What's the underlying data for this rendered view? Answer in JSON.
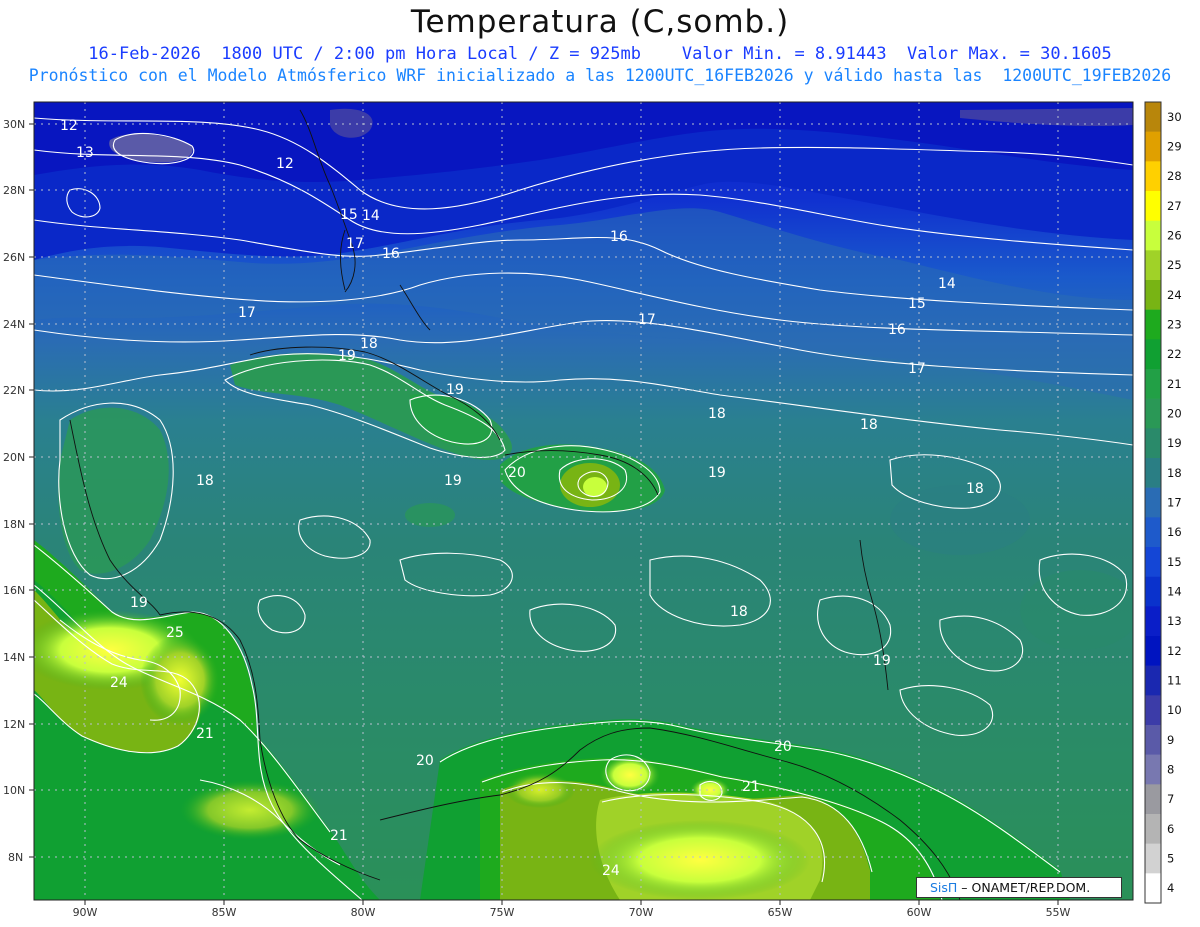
{
  "header": {
    "title": "Temperatura (C,somb.)",
    "line1": "16-Feb-2026  1800 UTC / 2:00 pm Hora Local / Z = 925mb    Valor Min. = 8.91443  Valor Max. = 30.1605",
    "line2": "Pronóstico con el Modelo Atmósferico WRF inicializado a las 1200UTC_16FEB2026 y válido hasta las  1200UTC_19FEB2026"
  },
  "credit": {
    "brand": "SisΠ",
    "text": " – ONAMET/REP.DOM."
  },
  "axes": {
    "lon_labels": [
      "90W",
      "85W",
      "80W",
      "75W",
      "70W",
      "65W",
      "60W",
      "55W"
    ],
    "lat_labels": [
      "30N",
      "28N",
      "26N",
      "24N",
      "22N",
      "20N",
      "18N",
      "16N",
      "14N",
      "12N",
      "10N",
      "8N"
    ]
  },
  "colorbar": {
    "levels": [
      "30",
      "29",
      "28",
      "27",
      "26",
      "25",
      "24",
      "23",
      "22",
      "21",
      "20",
      "19",
      "18",
      "17",
      "16",
      "15",
      "14",
      "13",
      "12",
      "11",
      "10",
      "9",
      "8",
      "7",
      "6",
      "5",
      "4"
    ],
    "colors": [
      "#b8860b",
      "#e0a000",
      "#ffd000",
      "#ffff00",
      "#c8ff3c",
      "#a0d228",
      "#78b414",
      "#1eaa1e",
      "#10a032",
      "#22a046",
      "#2a9856",
      "#2a8a6a",
      "#2a7e84",
      "#2a6cb4",
      "#1e5acb",
      "#1446d6",
      "#0a32cc",
      "#0a1ec8",
      "#0014c0",
      "#1a28b0",
      "#3c3ca8",
      "#5a5aa8",
      "#7878b0",
      "#9a9aa0",
      "#b4b4b4",
      "#d2d2d2",
      "#ffffff"
    ]
  },
  "contour_labels": [
    "12",
    "13",
    "12",
    "15",
    "14",
    "17",
    "16",
    "16",
    "14",
    "15",
    "16",
    "17",
    "17",
    "18",
    "19",
    "19",
    "17",
    "18",
    "18",
    "18",
    "20",
    "19",
    "19",
    "18",
    "18",
    "19",
    "25",
    "24",
    "21",
    "19",
    "20",
    "21",
    "20",
    "21",
    "24"
  ]
}
